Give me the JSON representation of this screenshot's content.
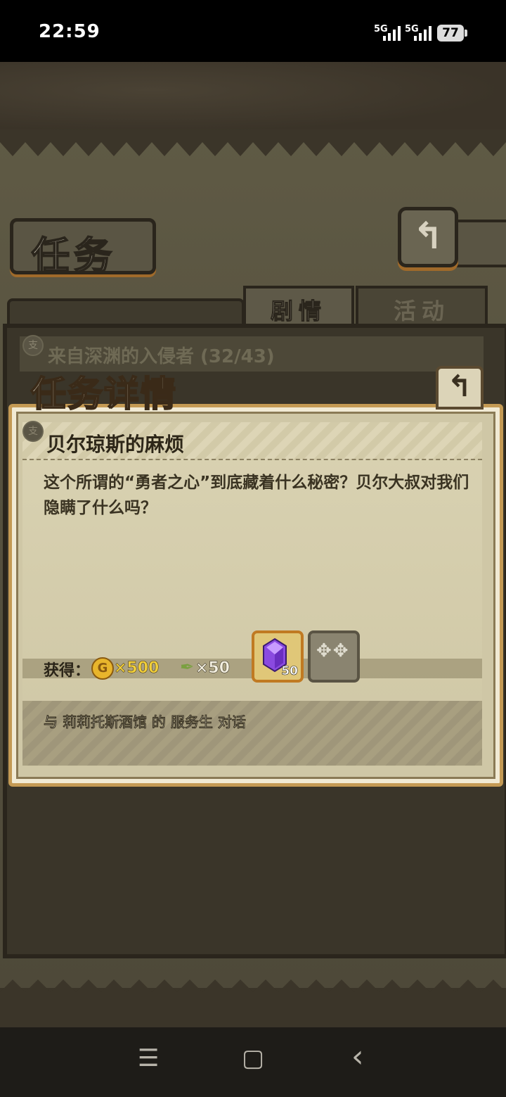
{
  "status_bar": {
    "time": "22:59",
    "signal1": "5G",
    "signal2": "5G",
    "battery": "77"
  },
  "screen": {
    "title": "任务",
    "tabs": [
      {
        "label": "剧情",
        "active": true
      },
      {
        "label": "活动",
        "active": false
      }
    ],
    "quest_list": [
      {
        "badge": "支",
        "title": "来自深渊的入侵者 (32/43)"
      }
    ]
  },
  "detail": {
    "header": "任务详情",
    "badge": "支",
    "subtitle": "贝尔琼斯的麻烦",
    "description": "这个所谓的“勇者之心”到底藏着什么秘密？贝尔大叔对我们隐瞒了什么吗？",
    "rewards": {
      "label": "获得：",
      "gold": "×500",
      "feather": "×50",
      "items": [
        {
          "icon": "purple-gem-icon",
          "count": "50"
        },
        {
          "icon": "silver-claws-icon",
          "count": ""
        }
      ]
    },
    "task": "与 莉莉托斯酒馆 的 服务生 对话"
  },
  "nav": {
    "menu_icon": "☰",
    "home_icon": "▢",
    "back_icon": "‹"
  },
  "colors": {
    "accent_gold": "#c49a54",
    "parchment": "#cfc7a6",
    "dark_frame": "#2a251c"
  }
}
